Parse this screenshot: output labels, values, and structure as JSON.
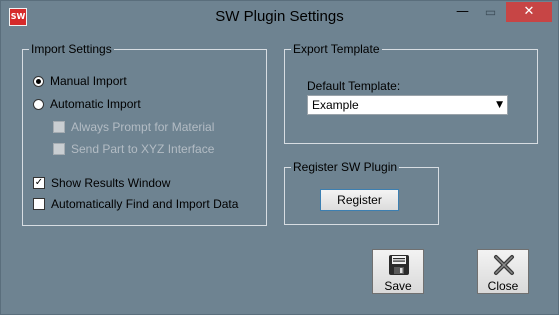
{
  "window": {
    "title": "SW Plugin Settings",
    "app_icon_text": "SW",
    "controls": {
      "minimize": "—",
      "restore": "▭",
      "close": "✕"
    }
  },
  "import_settings": {
    "legend": "Import Settings",
    "manual_import": {
      "label": "Manual Import",
      "selected": true
    },
    "automatic_import": {
      "label": "Automatic Import",
      "selected": false
    },
    "always_prompt": {
      "label": "Always Prompt for Material",
      "checked": false,
      "enabled": false
    },
    "send_part": {
      "label": "Send Part to XYZ Interface",
      "checked": false,
      "enabled": false
    },
    "show_results": {
      "label": "Show Results Window",
      "checked": true,
      "mark": "✓"
    },
    "auto_find": {
      "label": "Automatically Find and Import Data",
      "checked": false
    }
  },
  "export_template": {
    "legend": "Export Template",
    "default_template_label": "Default Template:",
    "default_template_value": "Example",
    "dropdown_arrow": "▼"
  },
  "register": {
    "legend": "Register SW Plugin",
    "button_label": "Register"
  },
  "actions": {
    "save_label": "Save",
    "close_label": "Close"
  }
}
